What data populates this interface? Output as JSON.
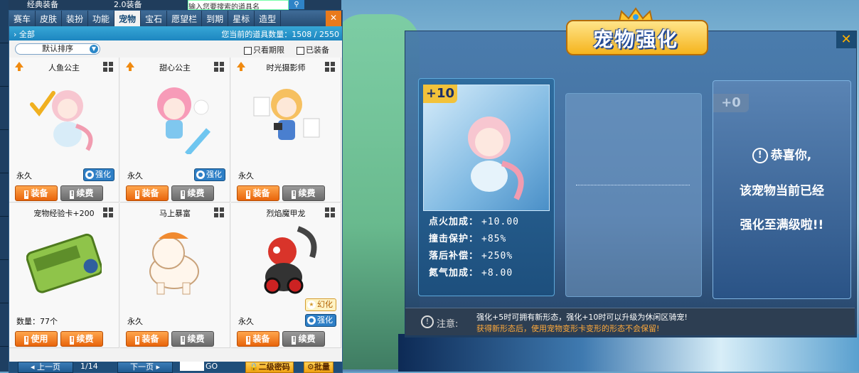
{
  "top_strip": {
    "classic_label": "经典装备",
    "v2_label": "2.0装备",
    "search_placeholder": "输入您要搜索的道具名"
  },
  "tabs": [
    "赛车",
    "皮肤",
    "装扮",
    "功能",
    "宠物",
    "宝石",
    "愿望栏",
    "到期",
    "星标",
    "造型"
  ],
  "active_tab": "宠物",
  "close_label": "✕",
  "all_label": "全部",
  "count_text": "您当前的道具数量：1508 / 2550",
  "sort": {
    "selected": "默认排序"
  },
  "filters": {
    "expiring": "只看期限",
    "equipped": "已装备"
  },
  "items": [
    {
      "name": "人鱼公主",
      "duration": "永久",
      "badge": "强化",
      "btn1": "装备",
      "btn2": "续费",
      "arrow": true
    },
    {
      "name": "甜心公主",
      "duration": "永久",
      "badge": "强化",
      "btn1": "装备",
      "btn2": "续费",
      "arrow": true
    },
    {
      "name": "时光摄影师",
      "duration": "永久",
      "badge": "",
      "btn1": "装备",
      "btn2": "续费",
      "arrow": true
    },
    {
      "name": "宠物经验卡+200",
      "duration": "数量：77个",
      "badge": "",
      "btn1": "使用",
      "btn2": "续费",
      "arrow": false
    },
    {
      "name": "马上暴富",
      "duration": "永久",
      "badge": "",
      "btn1": "装备",
      "btn2": "续费",
      "arrow": false
    },
    {
      "name": "烈焰魔甲龙",
      "duration": "永久",
      "badge": "强化",
      "badge2": "幻化",
      "btn1": "装备",
      "btn2": "续费",
      "arrow": false
    }
  ],
  "pager": {
    "prev": "上一页",
    "page": "1/14",
    "next": "下一页",
    "go": "GO",
    "pwd": "二级密码",
    "batch": "批量"
  },
  "enhance": {
    "title": "宠物强化",
    "close": "✕",
    "level_current": "+10",
    "level_next": "+0",
    "stats": [
      {
        "label": "点火加成：",
        "value": "+10.00"
      },
      {
        "label": "撞击保护：",
        "value": "+85%"
      },
      {
        "label": "落后补偿：",
        "value": "+250%"
      },
      {
        "label": "氮气加成：",
        "value": "+8.00"
      }
    ],
    "msg1": "恭喜你,",
    "msg2": "该宠物当前已经",
    "msg3": "强化至满级啦!!",
    "notice_label": "注意:",
    "notice_line1": "强化+5时可拥有新形态，强化+10时可以升级为休闲区骑宠!",
    "notice_line2": "获得新形态后，使用宠物变形卡变形的形态不会保留!"
  }
}
